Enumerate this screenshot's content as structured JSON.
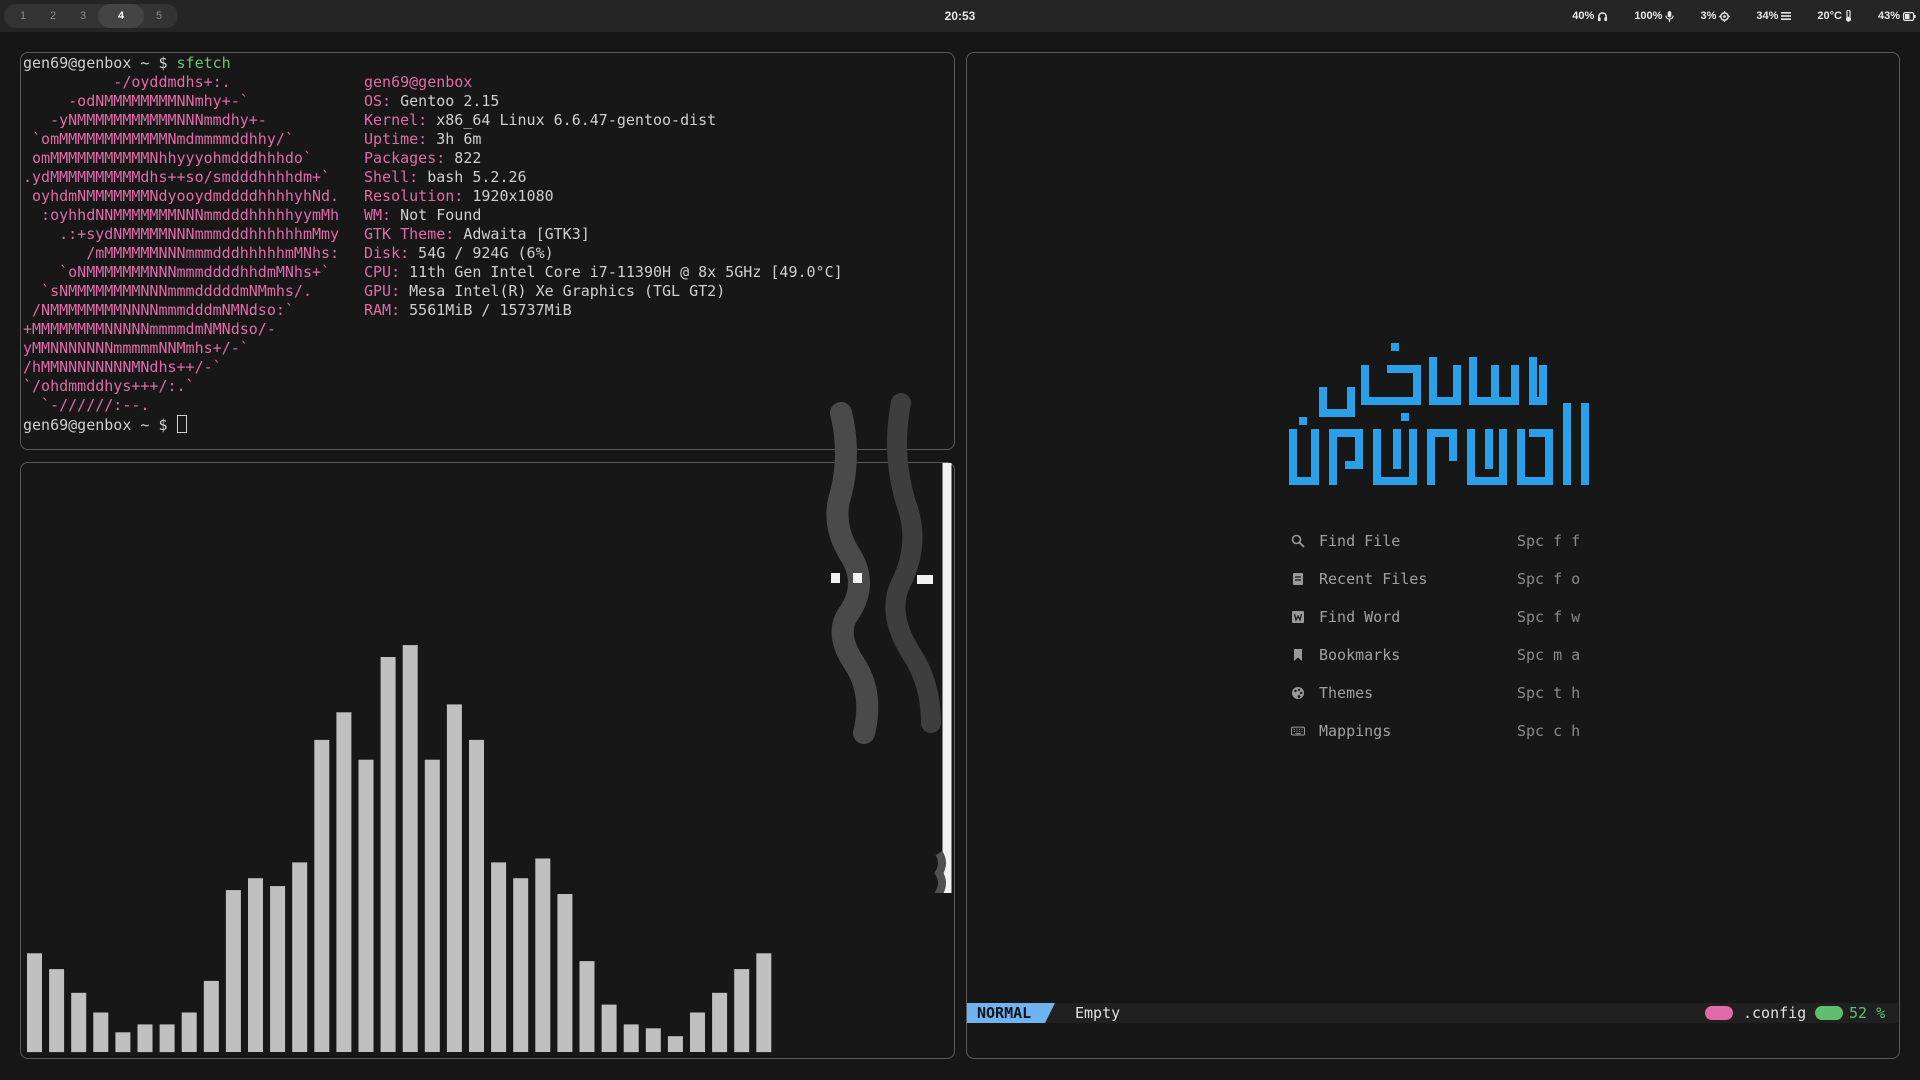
{
  "topbar": {
    "workspaces": [
      "1",
      "2",
      "3",
      "4",
      "5"
    ],
    "active_workspace": "4",
    "clock": "20:53",
    "status": [
      {
        "text": "40%",
        "icon": "headphones-icon"
      },
      {
        "text": "100%",
        "icon": "microphone-icon"
      },
      {
        "text": "3%",
        "icon": "cpu-icon"
      },
      {
        "text": "34%",
        "icon": "memory-icon"
      },
      {
        "text": "20°C",
        "icon": "thermometer-icon"
      },
      {
        "text": "43%",
        "icon": "battery-icon"
      }
    ]
  },
  "terminal": {
    "prompt": "gen69@genbox ~ $ ",
    "command": "sfetch",
    "logo": [
      "          -/oyddmdhs+:.",
      "     -odNMMMMMMMMNNmhy+-`",
      "   -yNMMMMMMMMMMMNNNmmdhy+-",
      " `omMMMMMMMMMMMMNmdmmmmddhhy/`",
      " omMMMMMMMMMMMNhhyyyohmdddhhhdo`",
      ".ydMMMMMMMMMMdhs++so/smdddhhhhdm+`",
      " oyhdmNMMMMMMMNdyooydmddddhhhhyhNd.",
      "  :oyhhdNNMMMMMMMNNNmmdddhhhhhyymMh",
      "    .:+sydNMMMMMNNNmmmdddhhhhhhmMmy",
      "       /mMMMMMMNNNmmmdddhhhhhmMNhs:",
      "    `oNMMMMMMMNNNmmmddddhhdmMNhs+`",
      "  `sNMMMMMMMMNNNmmmdddddmNMmhs/.",
      " /NMMMMMMMMNNNNmmmdddmNMNdso:`",
      "+MMMMMMMMNNNNNmmmmdmNMNdso/-",
      "yMMNNNNNNNmmmmmNNMmhs+/-`",
      "/hMMNNNNNNNNMNdhs++/-`",
      "`/ohdmmddhys+++/:.`",
      "  `-//////:--."
    ],
    "info": {
      "host": "gen69@genbox",
      "rows": [
        {
          "key": "OS:",
          "value": " Gentoo 2.15"
        },
        {
          "key": "Kernel:",
          "value": " x86_64 Linux 6.6.47-gentoo-dist"
        },
        {
          "key": "Uptime:",
          "value": " 3h 6m"
        },
        {
          "key": "Packages:",
          "value": " 822"
        },
        {
          "key": "Shell:",
          "value": " bash 5.2.26"
        },
        {
          "key": "Resolution:",
          "value": " 1920x1080"
        },
        {
          "key": "WM:",
          "value": " Not Found"
        },
        {
          "key": "GTK Theme:",
          "value": " Adwaita [GTK3]"
        },
        {
          "key": "Disk:",
          "value": " 54G / 924G (6%)"
        },
        {
          "key": "CPU:",
          "value": " 11th Gen Intel Core i7-11390H @ 8x 5GHz [49.0°C]"
        },
        {
          "key": "GPU:",
          "value": " Mesa Intel(R) Xe Graphics (TGL GT2)"
        },
        {
          "key": "RAM:",
          "value": " 5561MiB / 15737MiB"
        }
      ]
    }
  },
  "visualizer": {
    "bar_color": "#c0c0c0",
    "levels": [
      0.25,
      0.21,
      0.15,
      0.1,
      0.05,
      0.07,
      0.07,
      0.1,
      0.18,
      0.41,
      0.44,
      0.42,
      0.48,
      0.79,
      0.86,
      0.74,
      1.0,
      1.03,
      0.74,
      0.88,
      0.79,
      0.48,
      0.44,
      0.49,
      0.4,
      0.23,
      0.12,
      0.07,
      0.06,
      0.04,
      0.1,
      0.15,
      0.21,
      0.25
    ]
  },
  "nvim": {
    "accent": "#2aa0e8",
    "menu": [
      {
        "icon": "search-icon",
        "label": "Find File",
        "keys": "Spc f f"
      },
      {
        "icon": "file-icon",
        "label": "Recent Files",
        "keys": "Spc f o"
      },
      {
        "icon": "word-icon",
        "label": "Find Word",
        "keys": "Spc f w"
      },
      {
        "icon": "bookmark-icon",
        "label": "Bookmarks",
        "keys": "Spc m a"
      },
      {
        "icon": "palette-icon",
        "label": "Themes",
        "keys": "Spc t h"
      },
      {
        "icon": "keyboard-icon",
        "label": "Mappings",
        "keys": "Spc c h"
      }
    ],
    "statusline": {
      "mode": "NORMAL",
      "buffer": "Empty",
      "cwd": ".config",
      "percent": "52 %"
    }
  }
}
